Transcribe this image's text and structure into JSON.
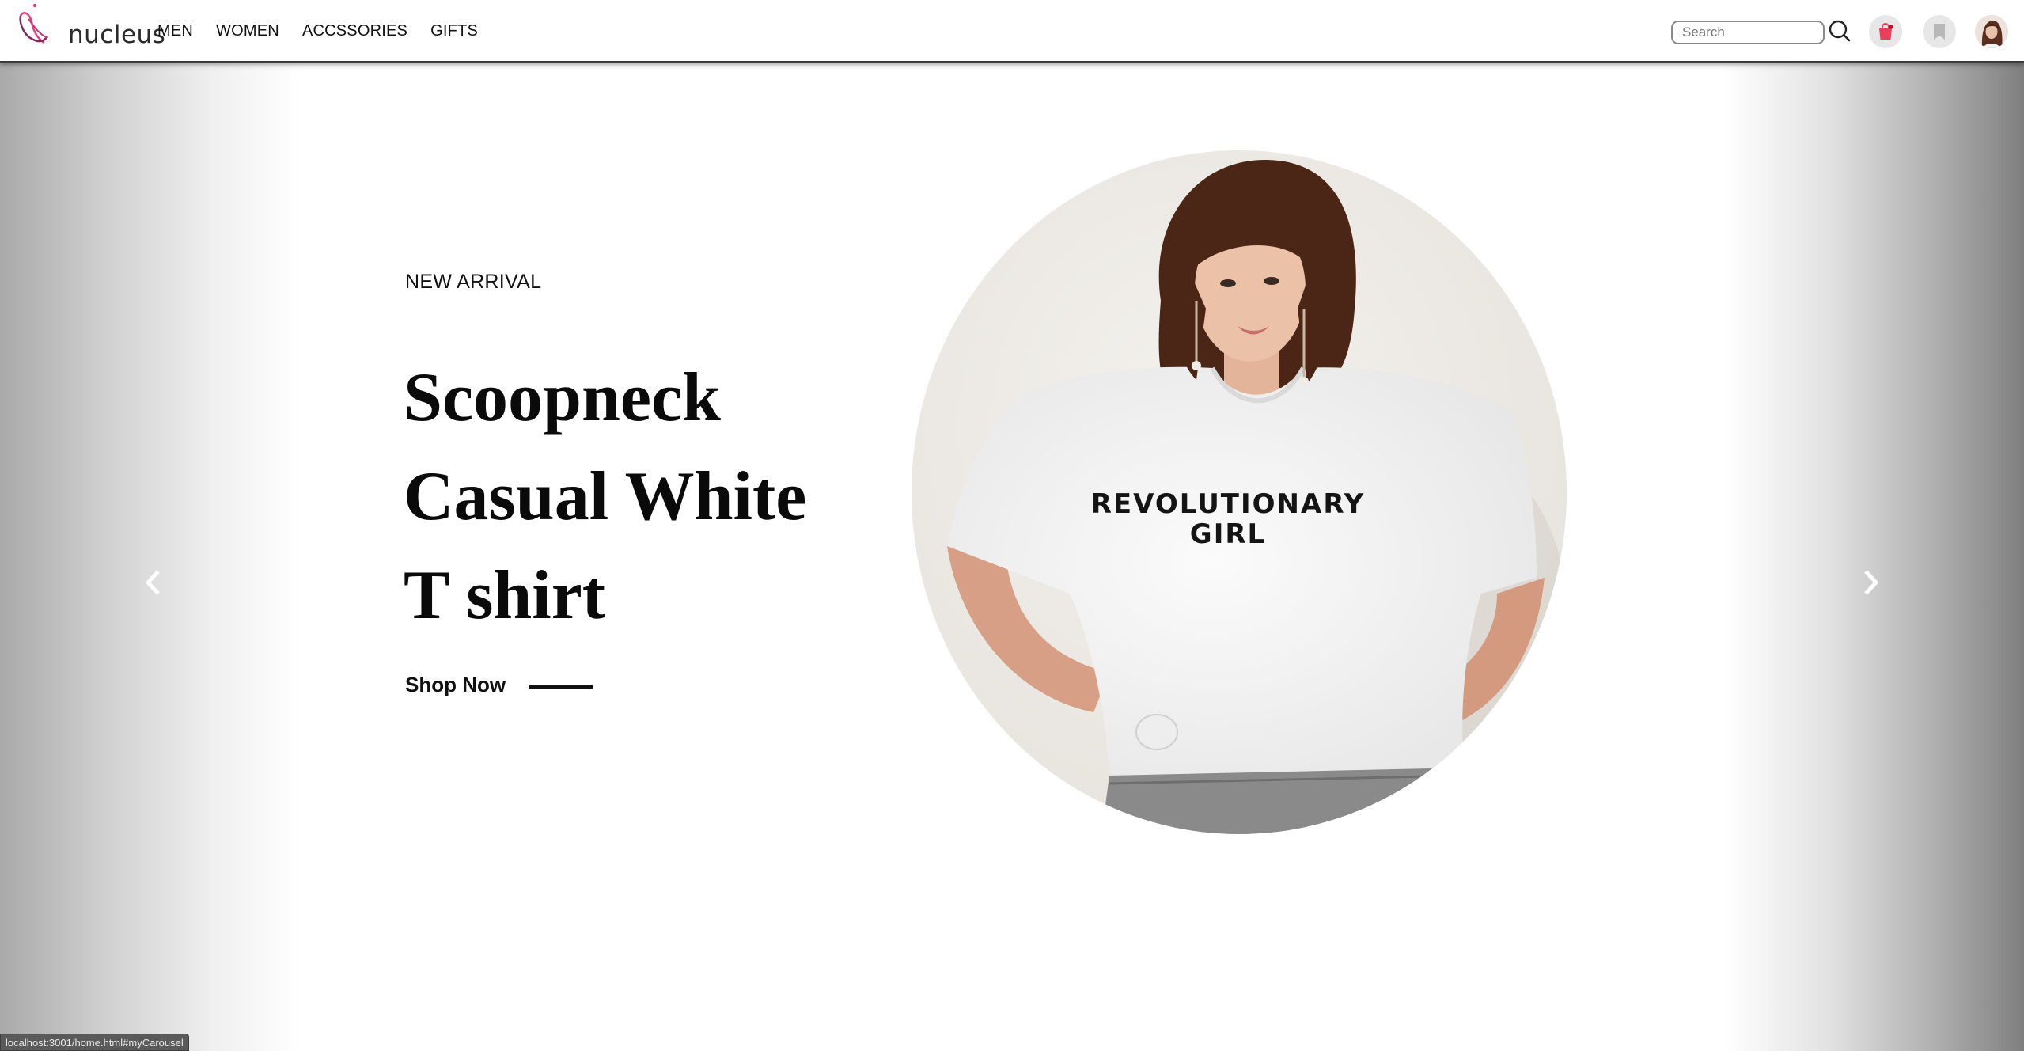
{
  "brand": {
    "name": "nucleus",
    "accent": "#e8407a"
  },
  "nav": {
    "links": [
      "MEN",
      "WOMEN",
      "ACCSSORIES",
      "GIFTS"
    ]
  },
  "search": {
    "placeholder": "Search",
    "icon": "search-icon"
  },
  "header_icons": {
    "cart": {
      "icon": "shopping-bag-icon",
      "color": "#e8405a"
    },
    "bookmark": {
      "icon": "bookmark-icon",
      "color": "#b8b8b8"
    },
    "avatar": {
      "icon": "avatar"
    }
  },
  "hero": {
    "eyebrow": "NEW ARRIVAL",
    "title_lines": [
      "Scoopneck",
      "Casual White",
      "T shirt"
    ],
    "cta": "Shop Now",
    "shirt_print": [
      "REVOLUTIONARY",
      "GIRL"
    ]
  },
  "carousel": {
    "prev_icon": "chevron-left-icon",
    "next_icon": "chevron-right-icon"
  },
  "status_bar": {
    "url": "localhost:3001/home.html#myCarousel"
  }
}
